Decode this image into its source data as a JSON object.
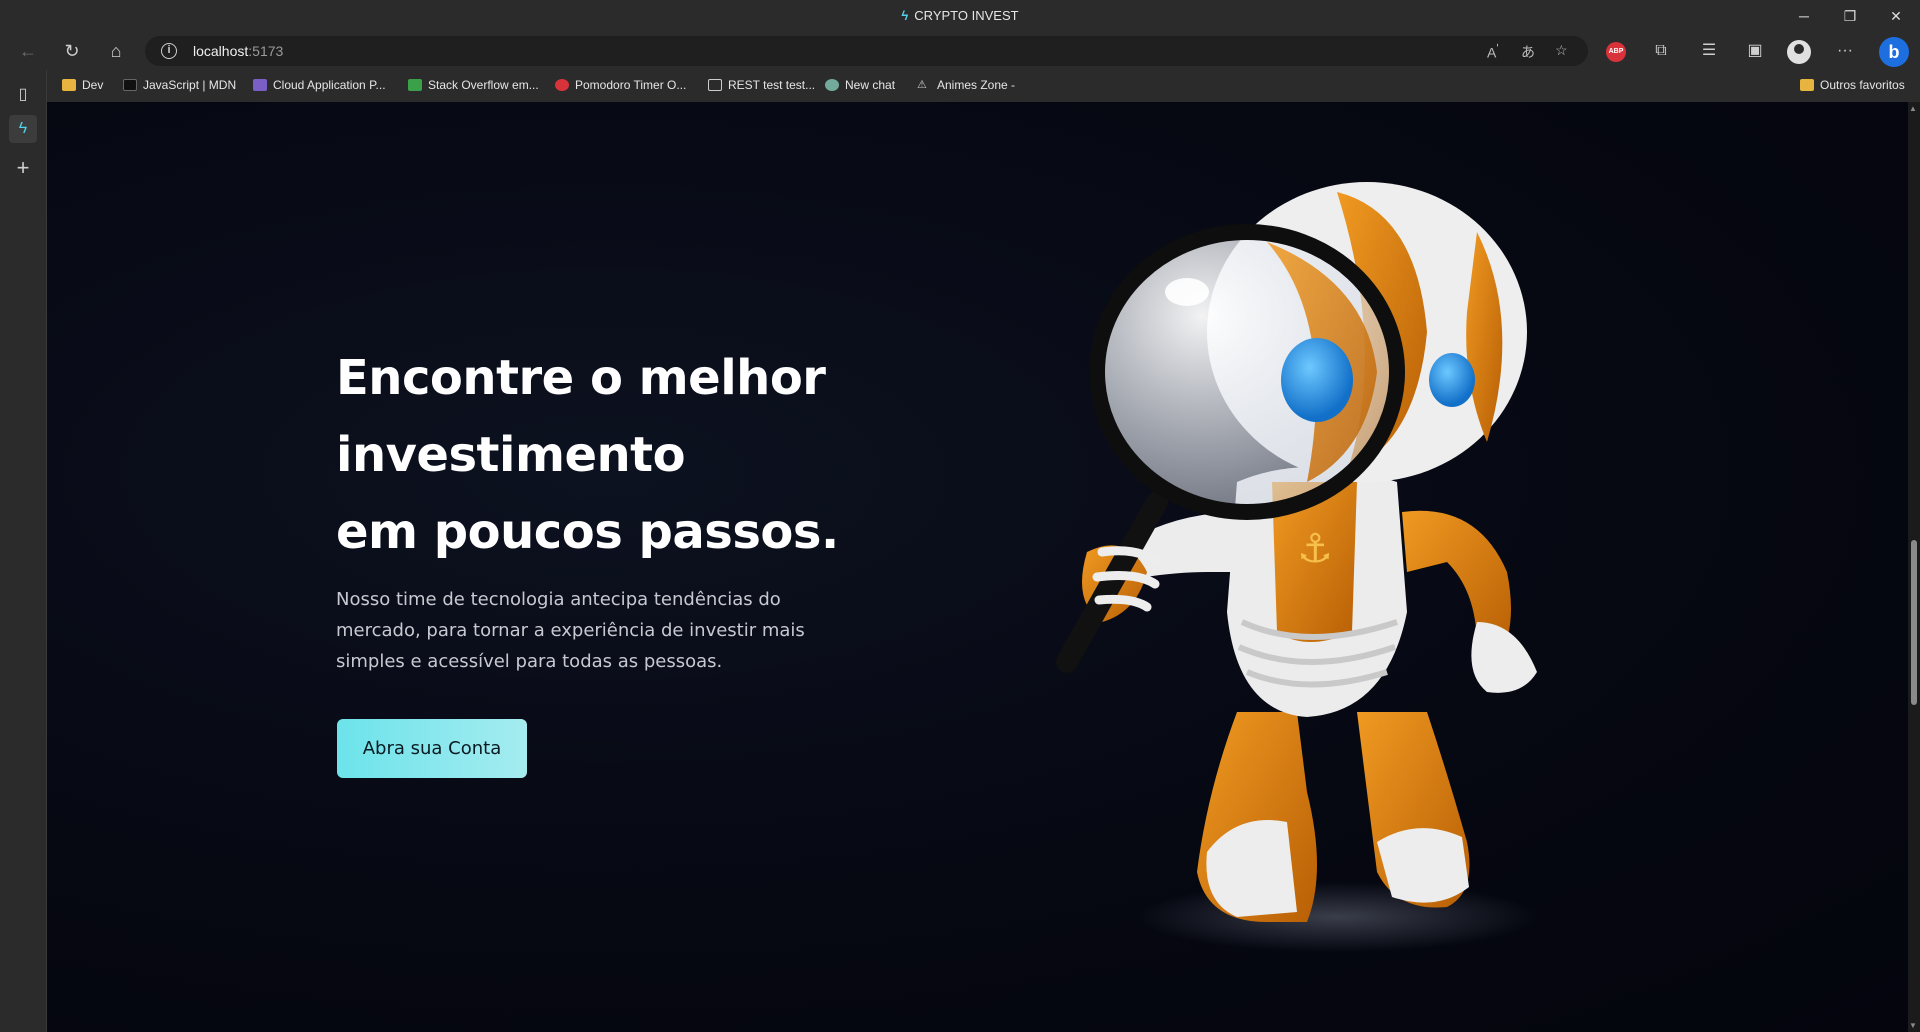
{
  "window": {
    "title": "CRYPTO INVEST"
  },
  "address_bar": {
    "host": "localhost",
    "port": ":5173"
  },
  "bookmarks": [
    {
      "label": "Dev",
      "icon": "folder-icon"
    },
    {
      "label": "JavaScript | MDN",
      "icon": "mdn-icon"
    },
    {
      "label": "Cloud Application P...",
      "icon": "heroku-icon"
    },
    {
      "label": "Stack Overflow em...",
      "icon": "stackoverflow-icon"
    },
    {
      "label": "Pomodoro Timer O...",
      "icon": "pomodoro-icon"
    },
    {
      "label": "REST test test...",
      "icon": "page-icon"
    },
    {
      "label": "New chat",
      "icon": "chatgpt-icon"
    },
    {
      "label": "Animes Zone -",
      "icon": "animes-icon"
    }
  ],
  "other_bookmarks": "Outros favoritos",
  "extensions": {
    "adblock_label": "ABP"
  },
  "hero": {
    "title_line1": "Encontre o melhor",
    "title_line2": "investimento",
    "title_line3": "em poucos passos.",
    "description": "Nosso time de tecnologia antecipa tendências do mercado, para tornar a experiência de investir mais simples e acessível para todas as pessoas.",
    "cta_label": "Abra sua Conta"
  },
  "colors": {
    "accent": "#6ce3ea",
    "page_background": "#05070f",
    "robot_orange": "#d9780a",
    "robot_eye": "#1b8fe0"
  }
}
